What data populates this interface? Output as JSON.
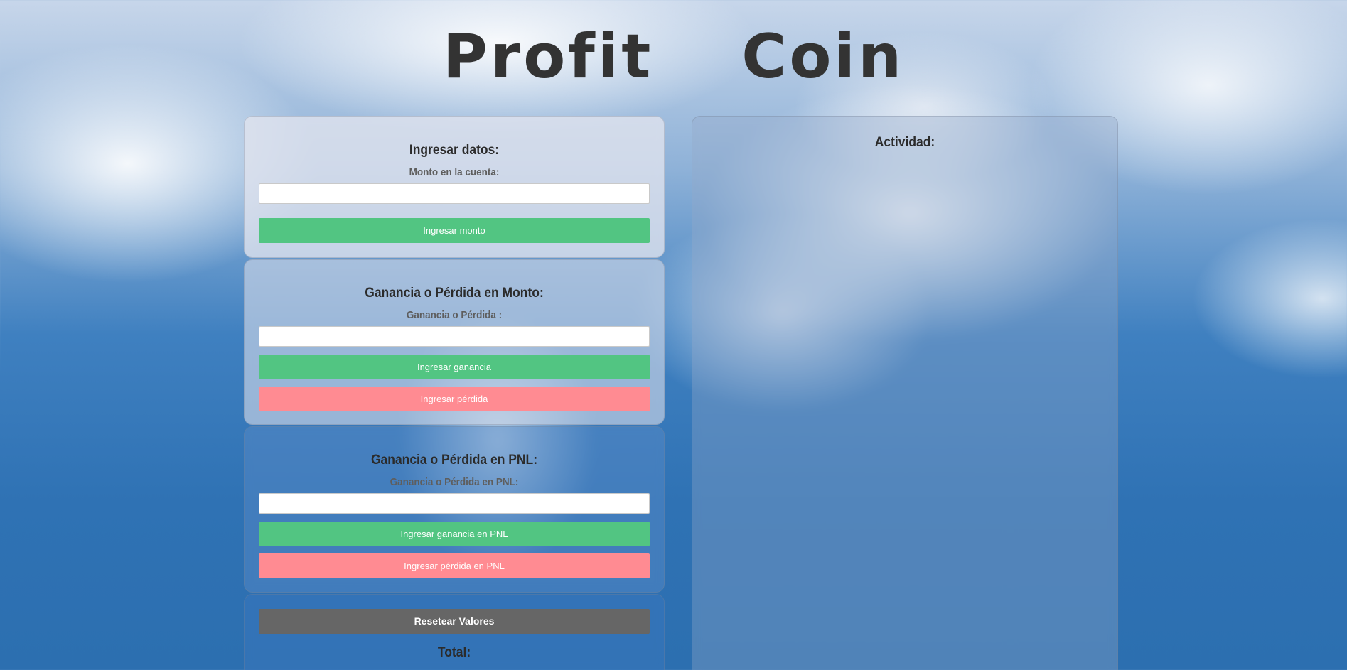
{
  "app": {
    "title": "Profit Coin"
  },
  "cards": {
    "entry": {
      "heading": "Ingresar datos:",
      "label": "Monto en la cuenta:",
      "input_value": "",
      "button": "Ingresar monto"
    },
    "amount_pnl": {
      "heading": "Ganancia o Pérdida en Monto:",
      "label": "Ganancia o Pérdida :",
      "input_value": "",
      "gain_button": "Ingresar ganancia",
      "loss_button": "Ingresar pérdida"
    },
    "pnl": {
      "heading": "Ganancia o Pérdida en PNL:",
      "label": "Ganancia o Pérdida en PNL:",
      "input_value": "",
      "gain_button": "Ingresar ganancia en PNL",
      "loss_button": "Ingresar pérdida en PNL"
    },
    "totals": {
      "reset_button": "Resetear Valores",
      "total_label": "Total:"
    }
  },
  "activity": {
    "heading": "Actividad:"
  },
  "colors": {
    "gain": "#52c582",
    "loss": "#ff8b92",
    "reset": "#666666",
    "title": "#333333"
  }
}
